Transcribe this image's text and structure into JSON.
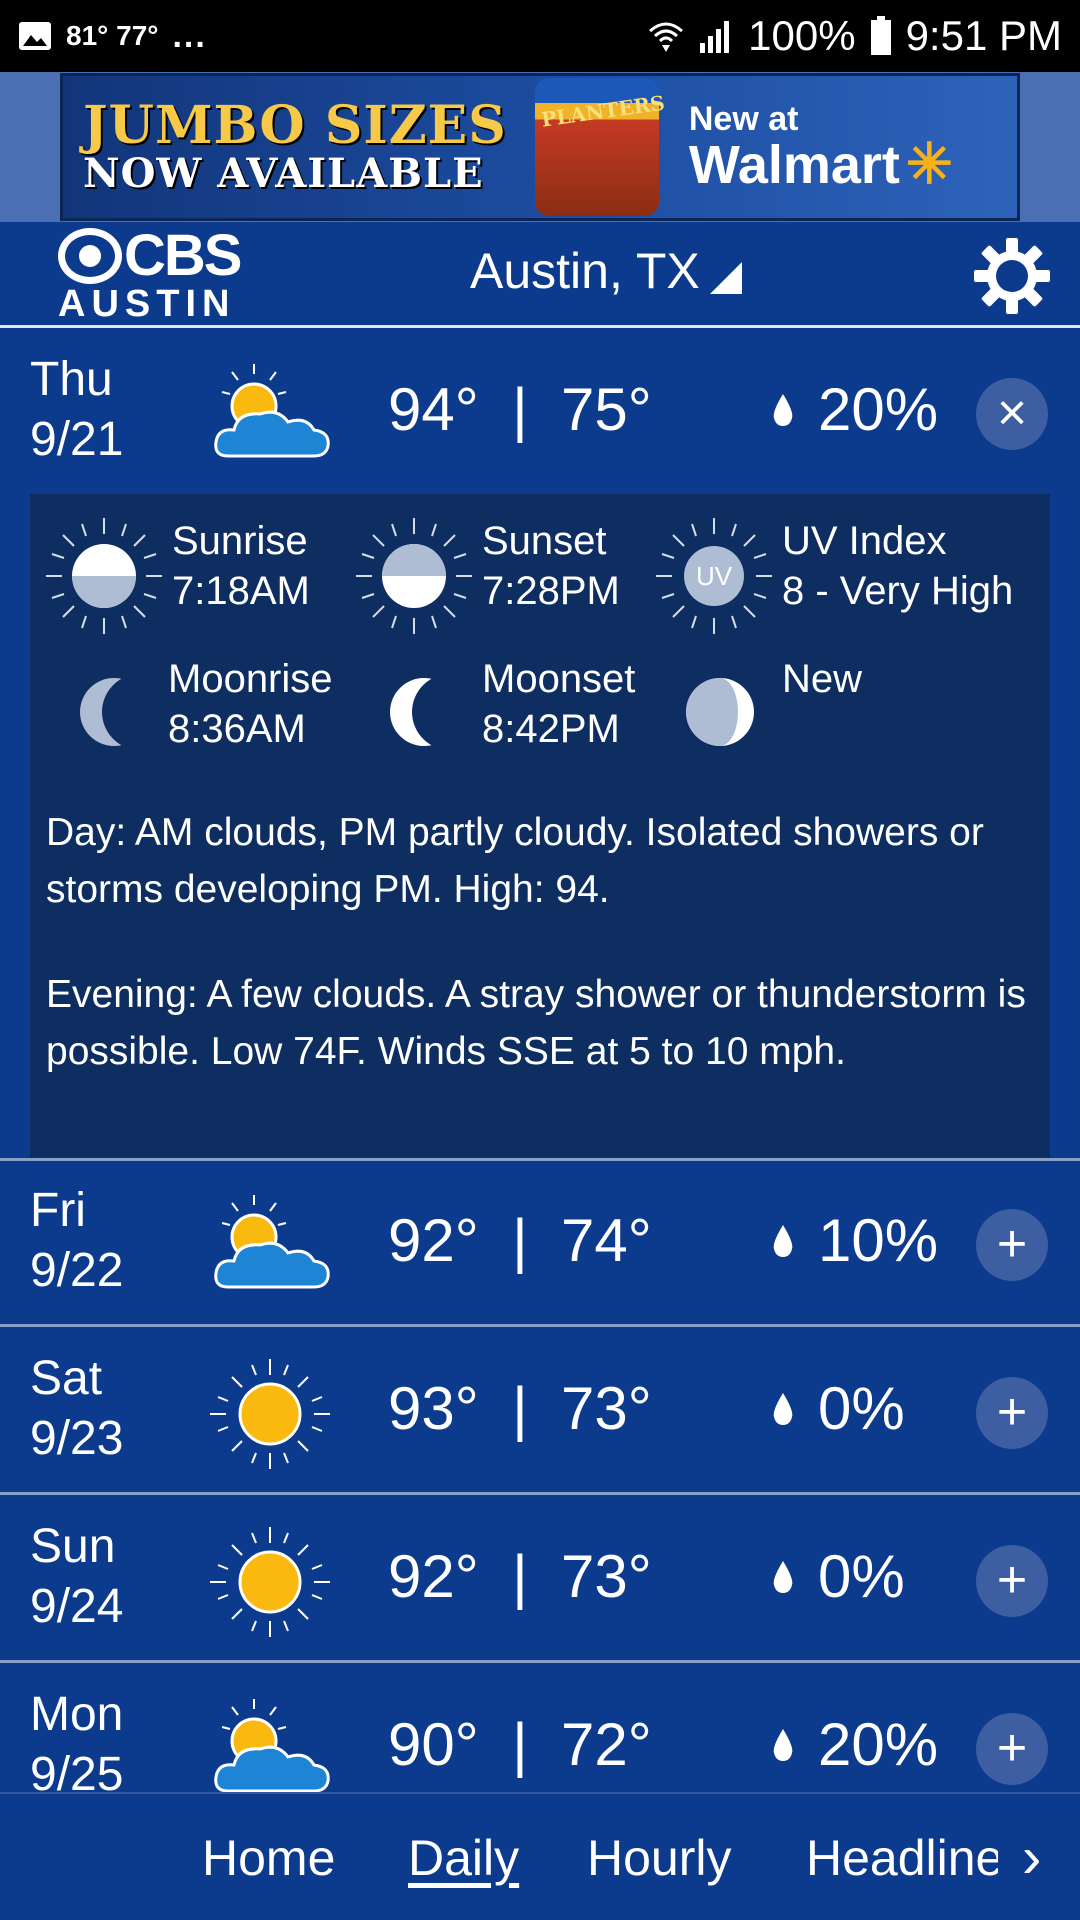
{
  "status_bar": {
    "temps": "81° 77°",
    "dots": "...",
    "battery": "100%",
    "time": "9:51 PM"
  },
  "ad": {
    "line1": "JUMBO SIZES",
    "line2": "NOW AVAILABLE",
    "brand": "PLANTERS",
    "new_at": "New at",
    "store": "Walmart"
  },
  "header": {
    "logo_network": "CBS",
    "logo_city": "AUSTIN",
    "location": "Austin, TX"
  },
  "days": [
    {
      "dow": "Thu",
      "date": "9/21",
      "high": "94°",
      "low": "75°",
      "precip": "20%",
      "icon": "partly-cloudy-icon",
      "button": "×",
      "expanded": true
    },
    {
      "dow": "Fri",
      "date": "9/22",
      "high": "92°",
      "low": "74°",
      "precip": "10%",
      "icon": "partly-cloudy-icon",
      "button": "+"
    },
    {
      "dow": "Sat",
      "date": "9/23",
      "high": "93°",
      "low": "73°",
      "precip": "0%",
      "icon": "sunny-icon",
      "button": "+"
    },
    {
      "dow": "Sun",
      "date": "9/24",
      "high": "92°",
      "low": "73°",
      "precip": "0%",
      "icon": "sunny-icon",
      "button": "+"
    },
    {
      "dow": "Mon",
      "date": "9/25",
      "high": "90°",
      "low": "72°",
      "precip": "20%",
      "icon": "partly-cloudy-icon",
      "button": "+"
    }
  ],
  "temp_separator": "|",
  "detail": {
    "sunrise_label": "Sunrise",
    "sunrise_time": "7:18AM",
    "sunset_label": "Sunset",
    "sunset_time": "7:28PM",
    "uv_label": "UV Index",
    "uv_value": "8 - Very High",
    "uv_badge": "UV",
    "moonrise_label": "Moonrise",
    "moonrise_time": "8:36AM",
    "moonset_label": "Moonset",
    "moonset_time": "8:42PM",
    "moon_phase": "New",
    "day_text": "Day: AM clouds, PM partly cloudy. Isolated showers or storms developing PM. High: 94.",
    "evening_text": "Evening: A few clouds. A stray shower or thunderstorm is possible. Low 74F. Winds SSE at 5 to 10 mph."
  },
  "nav": {
    "items": [
      "Home",
      "Daily",
      "Hourly",
      "Headlines"
    ],
    "active": "Daily"
  },
  "colors": {
    "background": "#0c3a8c",
    "detail_panel": "#0e2d60",
    "sun": "#f9b90f",
    "cloud": "#1e84d4"
  }
}
